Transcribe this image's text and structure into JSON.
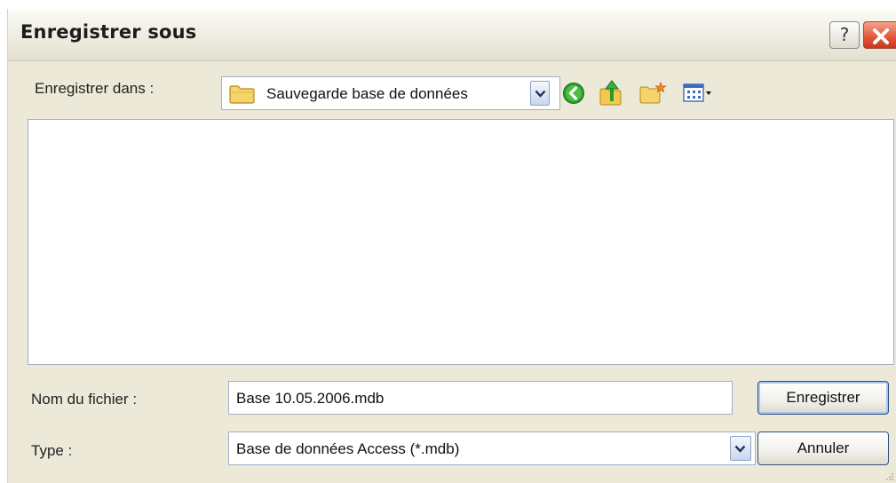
{
  "window": {
    "title": "Enregistrer sous",
    "help_label": "?",
    "close_icon": "close-icon"
  },
  "toolbar": {
    "save_in_label": "Enregistrer dans :",
    "location_value": "Sauvegarde base de données",
    "icons": [
      "folder-icon",
      "back-icon",
      "up-folder-icon",
      "new-folder-icon",
      "views-menu-icon"
    ]
  },
  "file_list": {
    "items": []
  },
  "form": {
    "filename_label": "Nom du fichier :",
    "filename_value": "Base 10.05.2006.mdb",
    "type_label": "Type :",
    "type_value": "Base de données Access (*.mdb)",
    "save_button": "Enregistrer",
    "cancel_button": "Annuler"
  },
  "colors": {
    "dialog_bg": "#ece9d8",
    "field_border": "#9fb1c8",
    "close_red": "#e0553a",
    "back_green": "#2f9a2a"
  }
}
